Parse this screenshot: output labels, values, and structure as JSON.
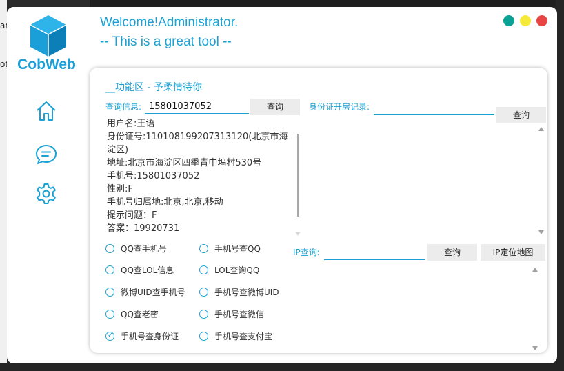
{
  "background": {
    "left_fragments": [
      "an",
      "ot"
    ]
  },
  "sidebar": {
    "brand": "CobWeb",
    "nav": [
      {
        "icon": "home-icon"
      },
      {
        "icon": "chat-icon"
      },
      {
        "icon": "gear-icon"
      }
    ]
  },
  "header": {
    "welcome": "Welcome!Administrator.",
    "tagline": "-- This is a great tool --"
  },
  "window_controls": {
    "colors": [
      "#0aa294",
      "#f5e93a",
      "#e84545"
    ]
  },
  "panel": {
    "title": "__功能区 - 予柔情待你",
    "query": {
      "label": "查询信息:",
      "value": "15801037052",
      "button": "查询"
    },
    "result_lines": [
      "用户名:王语",
      "身份证号:110108199207313120(北京市海淀区)",
      "地址:北京市海淀区四季青中坞村530号",
      "手机号:15801037052",
      "性别:F",
      "手机号归属地:北京,北京,移动",
      "提示问题：F",
      "答案：19920731"
    ],
    "id_record": {
      "label": "身份证开房记录:",
      "value": "",
      "button": "查询"
    },
    "ip_query": {
      "label": "IP查询:",
      "value": "",
      "button": "查询",
      "map_button": "IP定位地图"
    },
    "options_left": [
      {
        "label": "QQ查手机号",
        "checked": false
      },
      {
        "label": "QQ查LOL信息",
        "checked": false
      },
      {
        "label": "微博UID查手机号",
        "checked": false
      },
      {
        "label": "QQ查老密",
        "checked": false
      },
      {
        "label": "手机号查身份证",
        "checked": true
      }
    ],
    "options_right": [
      {
        "label": "手机号查QQ",
        "checked": false
      },
      {
        "label": "LOL查询QQ",
        "checked": false
      },
      {
        "label": "手机号查微博UID",
        "checked": false
      },
      {
        "label": "手机号查微信",
        "checked": false
      },
      {
        "label": "手机号查支付宝",
        "checked": false
      }
    ]
  },
  "accent_color": "#1ba1d4"
}
